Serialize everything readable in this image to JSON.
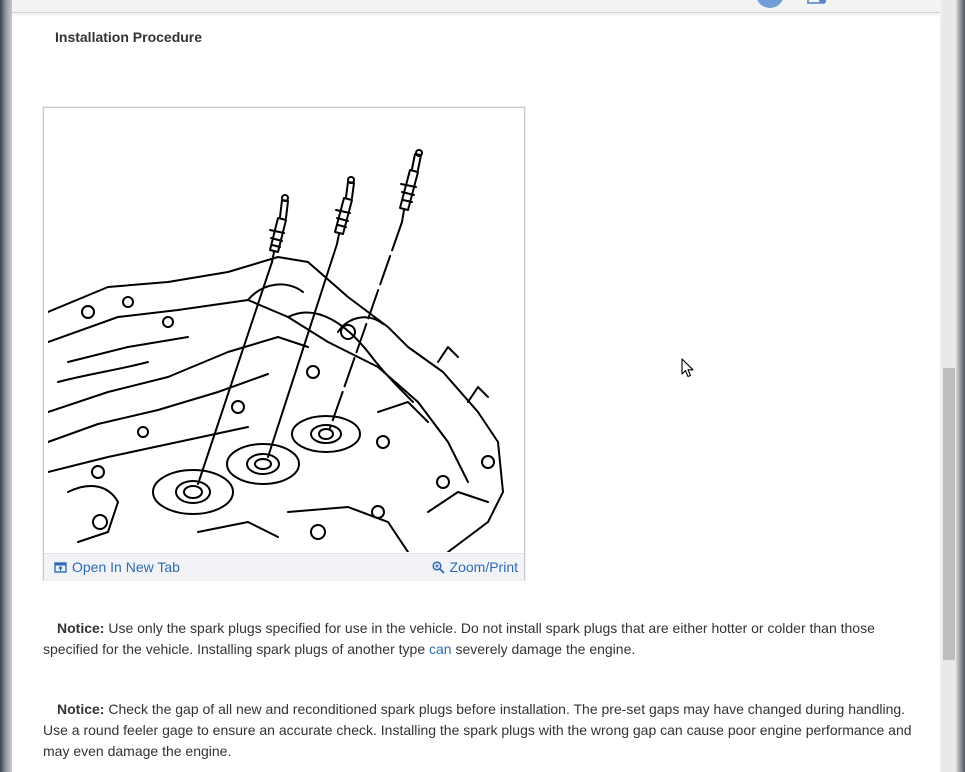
{
  "section": {
    "title": "Installation Procedure"
  },
  "figure": {
    "open_label": "Open In New Tab",
    "zoom_label": "Zoom/Print",
    "open_icon": "open-new-tab-icon",
    "zoom_icon": "magnifier-icon"
  },
  "notices": [
    {
      "label": "Notice:",
      "text_before": " Use only the spark plugs specified for use in the vehicle. Do not install spark plugs that are either hotter or colder than those specified for the vehicle. Installing spark plugs of another type ",
      "link": "can",
      "text_after": " severely damage the engine."
    },
    {
      "label": "Notice:",
      "text": " Check the gap of all new and reconditioned spark plugs before installation. The pre-set gaps may have changed during handling. Use a round feeler gage to ensure an accurate check. Installing the spark plugs with the wrong gap can cause poor engine performance and may even damage the engine."
    }
  ],
  "colors": {
    "link": "#2f6bb5",
    "text": "#333333",
    "accent": "#6f9fd6"
  }
}
